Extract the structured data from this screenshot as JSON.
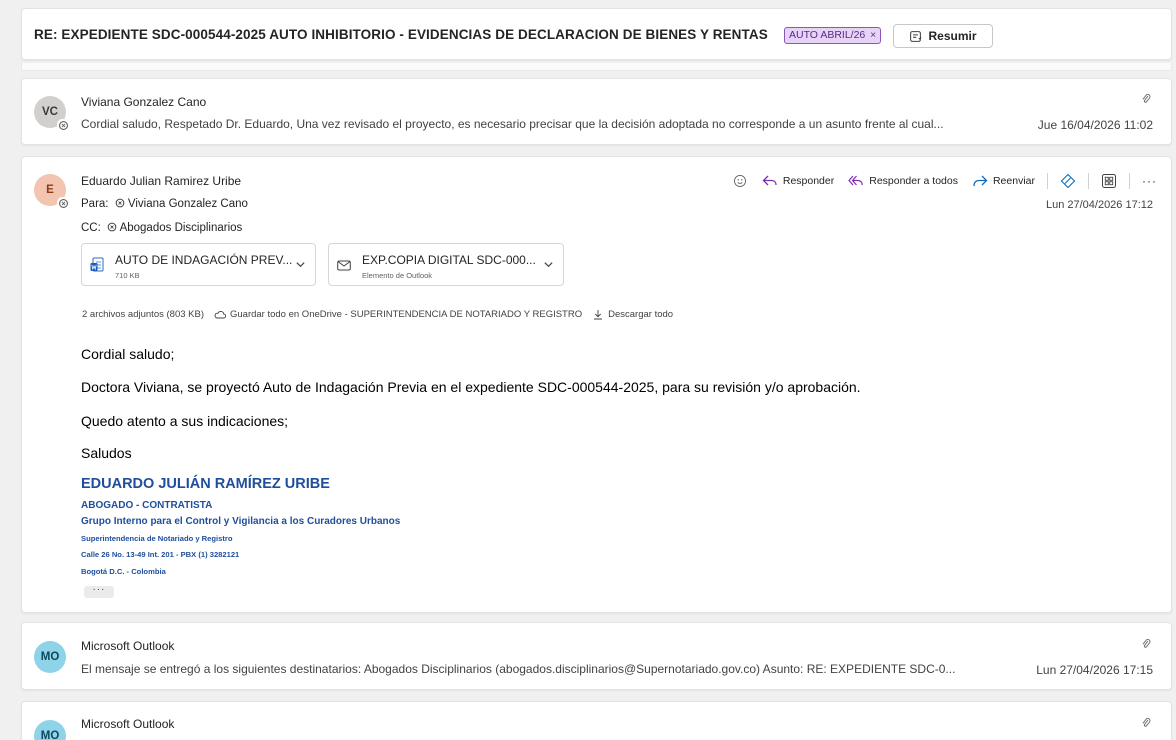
{
  "subject": {
    "title": "RE: EXPEDIENTE SDC-000544-2025 AUTO INHIBITORIO - EVIDENCIAS DE DECLARACION DE BIENES Y RENTAS",
    "tag_label": "AUTO ABRIL/26",
    "tag_remove": "×",
    "summarize_label": "Resumir"
  },
  "messages": [
    {
      "initials": "VC",
      "sender": "Viviana Gonzalez Cano",
      "preview": "Cordial saludo, Respetado Dr. Eduardo, Una vez revisado el proyecto, es necesario precisar que la decisión adoptada no corresponde a un asunto frente al cual...",
      "date": "Jue 16/04/2026 11:02"
    },
    {
      "initials": "E",
      "sender": "Eduardo Julian Ramirez Uribe",
      "to_label": "Para:",
      "to_name": "Viviana Gonzalez Cano",
      "cc_label": "CC:",
      "cc_name": "Abogados Disciplinarios",
      "date": "Lun 27/04/2026 17:12",
      "actions": {
        "reply": "Responder",
        "reply_all": "Responder a todos",
        "forward": "Reenviar",
        "more": "···"
      },
      "attachments": [
        {
          "name": "AUTO DE INDAGACIÓN PREV...",
          "meta": "710 KB",
          "icon": "word-doc-icon"
        },
        {
          "name": "EXP.COPIA DIGITAL SDC-000...",
          "meta": "Elemento de Outlook",
          "icon": "mail-item-icon"
        }
      ],
      "attachments_summary": "2 archivos adjuntos (803 KB)",
      "save_onedrive": "Guardar todo en OneDrive - SUPERINTENDENCIA DE NOTARIADO Y REGISTRO",
      "download_all": "Descargar todo",
      "body": [
        "Cordial saludo;",
        "Doctora Viviana, se proyectó Auto de Indagación Previa en el expediente SDC-000544-2025, para su revisión y/o aprobación.",
        "Quedo atento a sus indicaciones;",
        "Saludos"
      ],
      "signature": {
        "name": "EDUARDO JULIÁN RAMÍREZ URIBE",
        "role": "ABOGADO - CONTRATISTA",
        "group": "Grupo Interno para el Control y Vigilancia a los Curadores Urbanos",
        "org": "Superintendencia de Notariado y Registro",
        "address": "Calle 26 No. 13-49 Int. 201 - PBX (1) 3282121",
        "city": "Bogotá D.C. - Colombia"
      },
      "show_more": "···"
    },
    {
      "initials": "MO",
      "sender": "Microsoft Outlook",
      "preview": "El mensaje se entregó a los siguientes destinatarios: Abogados Disciplinarios (abogados.disciplinarios@Supernotariado.gov.co) Asunto: RE: EXPEDIENTE SDC-0...",
      "date": "Lun 27/04/2026 17:15"
    },
    {
      "initials": "MO",
      "sender": "Microsoft Outlook"
    }
  ],
  "colors": {
    "tag_bg": "#e7d3f7",
    "tag_border": "#8d54be",
    "reply_accent": "#7a2fb0",
    "forward_accent": "#0f6cbd",
    "signature": "#1f4e9c"
  }
}
